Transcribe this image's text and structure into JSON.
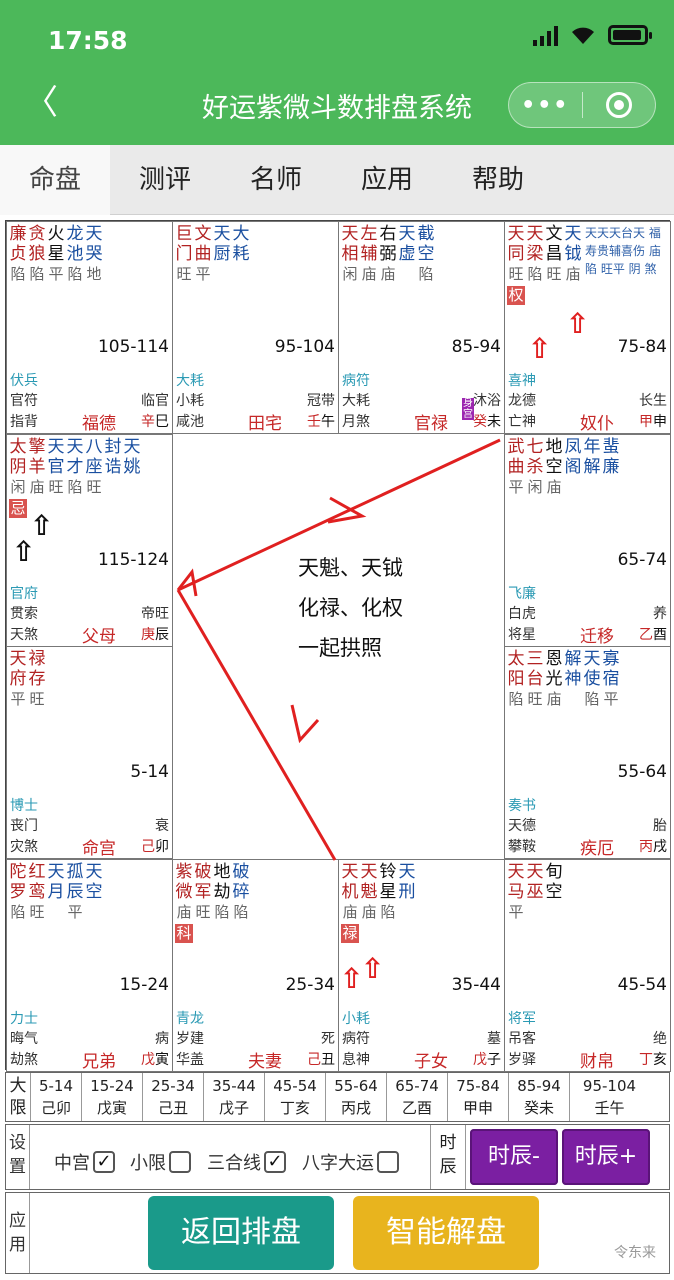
{
  "status": {
    "time": "17:58"
  },
  "nav": {
    "title": "好运紫微斗数排盘系统",
    "back": "〈",
    "more": "•••"
  },
  "tabs": [
    "命盘",
    "测评",
    "名师",
    "应用",
    "帮助"
  ],
  "cells": [
    {
      "id": "si",
      "stars": [
        [
          "廉",
          "贞",
          "陷"
        ],
        [
          "贪",
          "狼",
          "陷"
        ],
        [
          "火",
          "星",
          "平"
        ],
        [
          "龙",
          "池",
          "陷"
        ],
        [
          "天",
          "哭",
          "地"
        ]
      ],
      "range": "105-114",
      "g1": "伏兵",
      "g2": "官符",
      "g3": "指背",
      "cs": "临官",
      "palace": "福德",
      "gan": "辛",
      "zhi": "巳"
    },
    {
      "id": "wu",
      "stars": [
        [
          "巨",
          "门",
          "旺"
        ],
        [
          "文",
          "曲",
          "平"
        ],
        [
          "天",
          "厨",
          ""
        ],
        [
          "大",
          "耗",
          ""
        ]
      ],
      "range": "95-104",
      "g1": "大耗",
      "g2": "小耗",
      "g3": "咸池",
      "cs": "冠带",
      "palace": "田宅",
      "gan": "壬",
      "zhi": "午"
    },
    {
      "id": "wei",
      "stars": [
        [
          "天",
          "相",
          "闲"
        ],
        [
          "左",
          "辅",
          "庙"
        ],
        [
          "右",
          "弼",
          "庙"
        ],
        [
          "天",
          "虚",
          ""
        ],
        [
          "截",
          "空",
          "陷"
        ]
      ],
      "range": "85-94",
      "g1": "病符",
      "g2": "大耗",
      "g3": "月煞",
      "cs": "沐浴",
      "palace": "官禄",
      "gan": "癸",
      "zhi": "未",
      "tag": "身宫"
    },
    {
      "id": "shen",
      "stars": [
        [
          "天",
          "同",
          "旺"
        ],
        [
          "天",
          "梁",
          "陷"
        ],
        [
          "文",
          "昌",
          "旺"
        ],
        [
          "天",
          "钺",
          "庙"
        ]
      ],
      "aux": "天天天台天 福寿贵辅喜伤 庙陷 旺平 阴 煞",
      "range": "75-84",
      "g1": "喜神",
      "g2": "龙德",
      "g3": "亡神",
      "cs": "长生",
      "palace": "奴仆",
      "gan": "甲",
      "zhi": "申",
      "hua": "权"
    },
    {
      "id": "chen",
      "stars": [
        [
          "太",
          "阴",
          "闲"
        ],
        [
          "擎",
          "羊",
          "庙"
        ],
        [
          "天",
          "官",
          "旺"
        ],
        [
          "天",
          "才",
          "陷"
        ],
        [
          "八",
          "座",
          "旺"
        ],
        [
          "封",
          "诰",
          ""
        ],
        [
          "天",
          "姚",
          ""
        ]
      ],
      "range": "115-124",
      "g1": "官府",
      "g2": "贯索",
      "g3": "天煞",
      "cs": "帝旺",
      "palace": "父母",
      "gan": "庚",
      "zhi": "辰",
      "hua": "忌"
    },
    {
      "id": "you",
      "stars": [
        [
          "武",
          "曲",
          "平"
        ],
        [
          "七",
          "杀",
          "闲"
        ],
        [
          "地",
          "空",
          "庙"
        ],
        [
          "凤",
          "阁",
          ""
        ],
        [
          "年",
          "解",
          ""
        ],
        [
          "蜚",
          "廉",
          ""
        ]
      ],
      "range": "65-74",
      "g1": "飞廉",
      "g2": "白虎",
      "g3": "将星",
      "cs": "养",
      "palace": "迁移",
      "gan": "乙",
      "zhi": "酉"
    },
    {
      "id": "mao",
      "stars": [
        [
          "天",
          "府",
          "平"
        ],
        [
          "禄",
          "存",
          "旺"
        ]
      ],
      "range": "5-14",
      "g1": "博士",
      "g2": "丧门",
      "g3": "灾煞",
      "cs": "衰",
      "palace": "命宫",
      "gan": "己",
      "zhi": "卯"
    },
    {
      "id": "xu",
      "stars": [
        [
          "太",
          "阳",
          "陷"
        ],
        [
          "三",
          "台",
          "旺"
        ],
        [
          "恩",
          "光",
          "庙"
        ],
        [
          "解",
          "神",
          ""
        ],
        [
          "天",
          "使",
          "陷"
        ],
        [
          "寡",
          "宿",
          "平"
        ]
      ],
      "range": "55-64",
      "g1": "奏书",
      "g2": "天德",
      "g3": "攀鞍",
      "cs": "胎",
      "palace": "疾厄",
      "gan": "丙",
      "zhi": "戌"
    },
    {
      "id": "yin",
      "stars": [
        [
          "陀",
          "罗",
          "陷"
        ],
        [
          "红",
          "鸾",
          "旺"
        ],
        [
          "天",
          "月",
          ""
        ],
        [
          "孤",
          "辰",
          "平"
        ],
        [
          "天",
          "空",
          ""
        ]
      ],
      "range": "15-24",
      "g1": "力士",
      "g2": "晦气",
      "g3": "劫煞",
      "cs": "病",
      "palace": "兄弟",
      "gan": "戊",
      "zhi": "寅"
    },
    {
      "id": "chou",
      "stars": [
        [
          "紫",
          "微",
          "庙"
        ],
        [
          "破",
          "军",
          "旺"
        ],
        [
          "地",
          "劫",
          "陷"
        ],
        [
          "破",
          "碎",
          "陷"
        ]
      ],
      "range": "25-34",
      "g1": "青龙",
      "g2": "岁建",
      "g3": "华盖",
      "cs": "死",
      "palace": "夫妻",
      "gan": "己",
      "zhi": "丑",
      "hua": "科"
    },
    {
      "id": "zi",
      "stars": [
        [
          "天",
          "机",
          "庙"
        ],
        [
          "天",
          "魁",
          "庙"
        ],
        [
          "铃",
          "星",
          "陷"
        ],
        [
          "天",
          "刑",
          ""
        ]
      ],
      "range": "35-44",
      "g1": "小耗",
      "g2": "病符",
      "g3": "息神",
      "cs": "墓",
      "palace": "子女",
      "gan": "戊",
      "zhi": "子",
      "hua": "禄"
    },
    {
      "id": "hai",
      "stars": [
        [
          "天",
          "马",
          "平"
        ],
        [
          "天",
          "巫",
          ""
        ],
        [
          "旬",
          "空",
          ""
        ]
      ],
      "range": "45-54",
      "g1": "将军",
      "g2": "吊客",
      "g3": "岁驿",
      "cs": "绝",
      "palace": "财帛",
      "gan": "丁",
      "zhi": "亥"
    }
  ],
  "center": {
    "line1": "天魁、天钺",
    "line2": "化禄、化权",
    "line3": "一起拱照"
  },
  "decade": {
    "label": [
      "大",
      "限"
    ],
    "items": [
      [
        "5-14",
        "己卯"
      ],
      [
        "15-24",
        "戊寅"
      ],
      [
        "25-34",
        "己丑"
      ],
      [
        "35-44",
        "戊子"
      ],
      [
        "45-54",
        "丁亥"
      ],
      [
        "55-64",
        "丙戌"
      ],
      [
        "65-74",
        "乙酉"
      ],
      [
        "75-84",
        "甲申"
      ],
      [
        "85-94",
        "癸未"
      ],
      [
        "95-104",
        "壬午"
      ]
    ]
  },
  "settings": {
    "label": [
      "设",
      "置"
    ],
    "opt1": "中宫",
    "opt2": "小限",
    "opt3": "三合线",
    "opt4": "八字大运",
    "shichen_label": [
      "时",
      "辰"
    ],
    "minus": "时辰-",
    "plus": "时辰+"
  },
  "apply": {
    "label": [
      "应",
      "用"
    ],
    "back_btn": "返回排盘",
    "smart_btn": "智能解盘"
  },
  "watermark": "令东来",
  "colors": {
    "green": "#4cb85a",
    "teal": "#1a9a8a",
    "gold": "#e8b41e",
    "purple": "#7b1fa2",
    "red": "#e02020"
  }
}
